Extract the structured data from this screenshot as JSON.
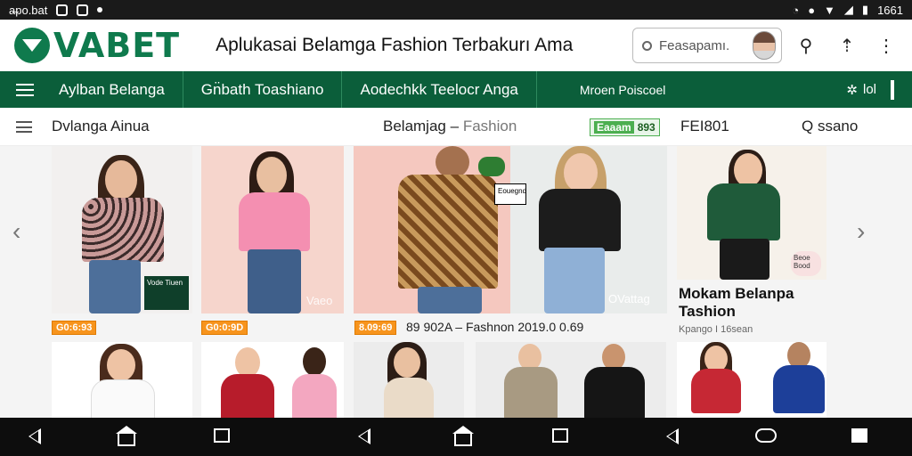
{
  "status_bar": {
    "app_name": "a̶po.bat",
    "time": "1661"
  },
  "header": {
    "logo_text": "VABET",
    "tagline": "Aplukasai Belamga Fashion Terbakurı Ama",
    "search_placeholder": "Feasapamı."
  },
  "navbar": {
    "items": [
      "Aylban Belanga",
      "Gn̈bath Toashiano",
      "Aodechkk Teelocr Anga",
      "Mroen Poiscoel"
    ],
    "right_label": "lol"
  },
  "subbar": {
    "left_label": "Dvlanga Ainua",
    "crumb_main": "Belamjag",
    "crumb_sep": "–",
    "crumb_sub": "Fashion",
    "badge_a": "Eaaam",
    "badge_b": "893",
    "right_1": "FEI801",
    "right_2": "Q ssano"
  },
  "products": {
    "price_tags": [
      "G0:6:93",
      "G0:0:9D",
      "8.09:69"
    ],
    "caption_3": "89 902A – Fashnon 2019.0 0.69",
    "overlay_1": "Vode Tiuen",
    "overlay_2": "Eouegnd",
    "watermark_2": "Vaeo",
    "watermark_3": "OVattag",
    "card4_title": "Mokam Belanpa Tashion",
    "card4_sub": "Kpango I 16sean",
    "card4_bubble": "Beoe Bood"
  },
  "colors": {
    "brand_green": "#0f7a4d",
    "nav_green": "#0b5e3a",
    "accent_orange": "#f7941d"
  }
}
